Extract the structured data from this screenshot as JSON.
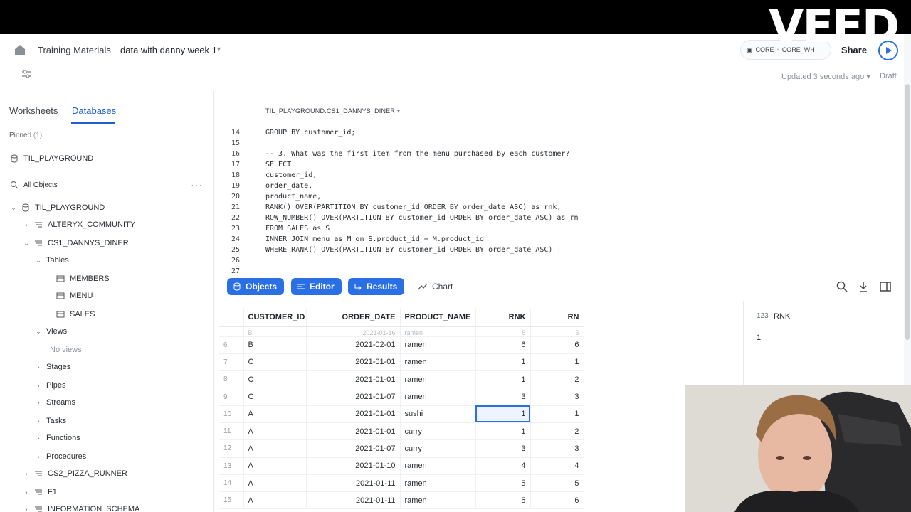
{
  "watermark": "VEED",
  "header": {
    "breadcrumb_1": "Training Materials",
    "breadcrumb_2": "data with danny week 1",
    "role": "CORE",
    "warehouse": "CORE_WH",
    "share_label": "Share",
    "updated_text": "Updated 3 seconds ago",
    "status": "Draft"
  },
  "sidebar": {
    "tabs": [
      "Worksheets",
      "Databases"
    ],
    "pinned_label": "Pinned",
    "pinned_count": "(1)",
    "pinned_db": "TIL_PLAYGROUND",
    "all_objects": "All Objects",
    "tree": {
      "db": "TIL_PLAYGROUND",
      "schema_1": "ALTERYX_COMMUNITY",
      "schema_2": "CS1_DANNYS_DINER",
      "tables_label": "Tables",
      "tables": [
        "MEMBERS",
        "MENU",
        "SALES"
      ],
      "views_label": "Views",
      "no_views": "No views",
      "stages": "Stages",
      "pipes": "Pipes",
      "streams": "Streams",
      "tasks": "Tasks",
      "functions": "Functions",
      "procedures": "Procedures",
      "schema_3": "CS2_PIZZA_RUNNER",
      "schema_4": "F1",
      "schema_5": "INFORMATION_SCHEMA"
    }
  },
  "editor": {
    "context": "TIL_PLAYGROUND.CS1_DANNYS_DINER",
    "lines": [
      {
        "n": "14",
        "t": "GROUP BY customer_id;"
      },
      {
        "n": "15",
        "t": ""
      },
      {
        "n": "16",
        "t": "-- 3. What was the first item from the menu purchased by each customer?"
      },
      {
        "n": "17",
        "t": "SELECT"
      },
      {
        "n": "18",
        "t": "customer_id,"
      },
      {
        "n": "19",
        "t": "order_date,"
      },
      {
        "n": "20",
        "t": "product_name,"
      },
      {
        "n": "21",
        "t": "RANK() OVER(PARTITION BY customer_id ORDER BY order_date ASC) as rnk,"
      },
      {
        "n": "22",
        "t": "ROW_NUMBER() OVER(PARTITION BY customer_id ORDER BY order_date ASC) as rn"
      },
      {
        "n": "23",
        "t": "FROM SALES as S"
      },
      {
        "n": "24",
        "t": "INNER JOIN menu as M on S.product_id = M.product_id"
      },
      {
        "n": "25",
        "t": "WHERE RANK() OVER(PARTITION BY customer_id ORDER BY order_date ASC) |"
      },
      {
        "n": "26",
        "t": ""
      },
      {
        "n": "27",
        "t": ""
      }
    ]
  },
  "toolbar": {
    "objects": "Objects",
    "editor": "Editor",
    "results": "Results",
    "chart": "Chart"
  },
  "results": {
    "columns": [
      "CUSTOMER_ID",
      "ORDER_DATE",
      "PRODUCT_NAME",
      "RNK",
      "RN"
    ],
    "partial_row": [
      "",
      "B",
      "2021-01-16",
      "ramen",
      "5",
      "5"
    ],
    "rows": [
      [
        "6",
        "B",
        "2021-02-01",
        "ramen",
        "6",
        "6"
      ],
      [
        "7",
        "C",
        "2021-01-01",
        "ramen",
        "1",
        "1"
      ],
      [
        "8",
        "C",
        "2021-01-01",
        "ramen",
        "1",
        "2"
      ],
      [
        "9",
        "C",
        "2021-01-07",
        "ramen",
        "3",
        "3"
      ],
      [
        "10",
        "A",
        "2021-01-01",
        "sushi",
        "1",
        "1"
      ],
      [
        "11",
        "A",
        "2021-01-01",
        "curry",
        "1",
        "2"
      ],
      [
        "12",
        "A",
        "2021-01-07",
        "curry",
        "3",
        "3"
      ],
      [
        "13",
        "A",
        "2021-01-10",
        "ramen",
        "4",
        "4"
      ],
      [
        "14",
        "A",
        "2021-01-11",
        "ramen",
        "5",
        "5"
      ],
      [
        "15",
        "A",
        "2021-01-11",
        "ramen",
        "5",
        "6"
      ]
    ]
  },
  "inspector": {
    "type": "123",
    "column": "RNK",
    "value": "1"
  }
}
